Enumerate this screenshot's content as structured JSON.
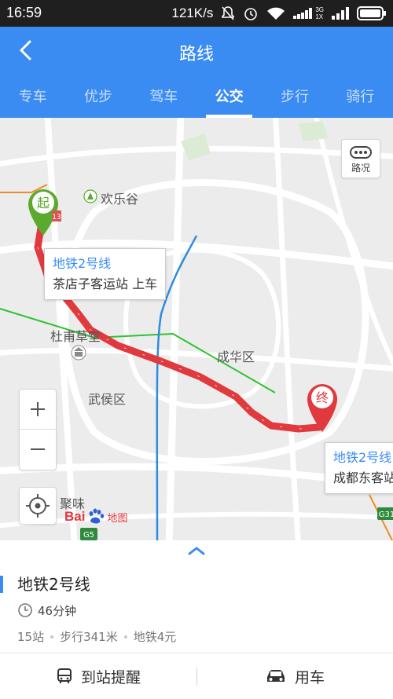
{
  "status": {
    "time": "16:59",
    "speed": "121K/s",
    "net_label_top": "3G",
    "net_label_bottom": "1X"
  },
  "header": {
    "title": "路线",
    "tabs": [
      {
        "label": "专车"
      },
      {
        "label": "优步"
      },
      {
        "label": "驾车"
      },
      {
        "label": "公交",
        "active": true
      },
      {
        "label": "步行"
      },
      {
        "label": "骑行"
      }
    ]
  },
  "map": {
    "start_marker": "起",
    "end_marker": "终",
    "traffic_label": "路况",
    "places": [
      "欢乐谷",
      "杜甫草堂",
      "成华区",
      "武侯区",
      "聚味"
    ],
    "road_signs": [
      "G5",
      "G31",
      "13"
    ],
    "logo_text": "Bai",
    "logo_map": "地图",
    "callout_start": {
      "line": "地铁2号线",
      "stop": "茶店子客运站 上车"
    },
    "callout_end": {
      "line": "地铁2号线",
      "stop": "成都东客站 下车"
    }
  },
  "result": {
    "line_name": "地铁2号线",
    "duration": "46分钟",
    "stations": "15站",
    "walk": "步行341米",
    "fare": "地铁4元"
  },
  "footer": {
    "remind_label": "到站提醒",
    "car_label": "用车"
  },
  "colors": {
    "accent": "#3a8cf3",
    "route": "#e0393e",
    "start": "#5aaa2d",
    "end": "#e0393e"
  }
}
